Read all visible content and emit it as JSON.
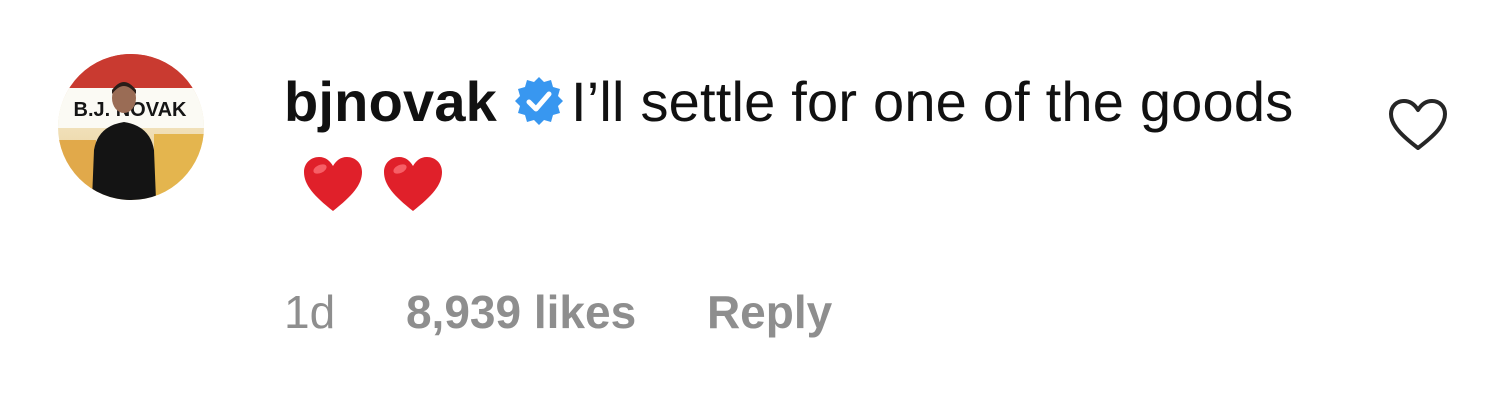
{
  "comment": {
    "username": "bjnovak",
    "text": "I’ll settle for one of the goods",
    "emoji_names": [
      "red-heart-emoji",
      "red-heart-emoji"
    ]
  },
  "avatar": {
    "sign_text": "B.J. NOVAK"
  },
  "meta": {
    "time": "1d",
    "likes": "8,939 likes",
    "reply_label": "Reply"
  },
  "icons": {
    "verified": "verified-badge-icon",
    "like": "heart-outline-icon"
  },
  "colors": {
    "verified_blue": "#3897f0",
    "emoji_red": "#e0202a",
    "meta_gray": "#8e8e8e",
    "text": "#111111"
  }
}
